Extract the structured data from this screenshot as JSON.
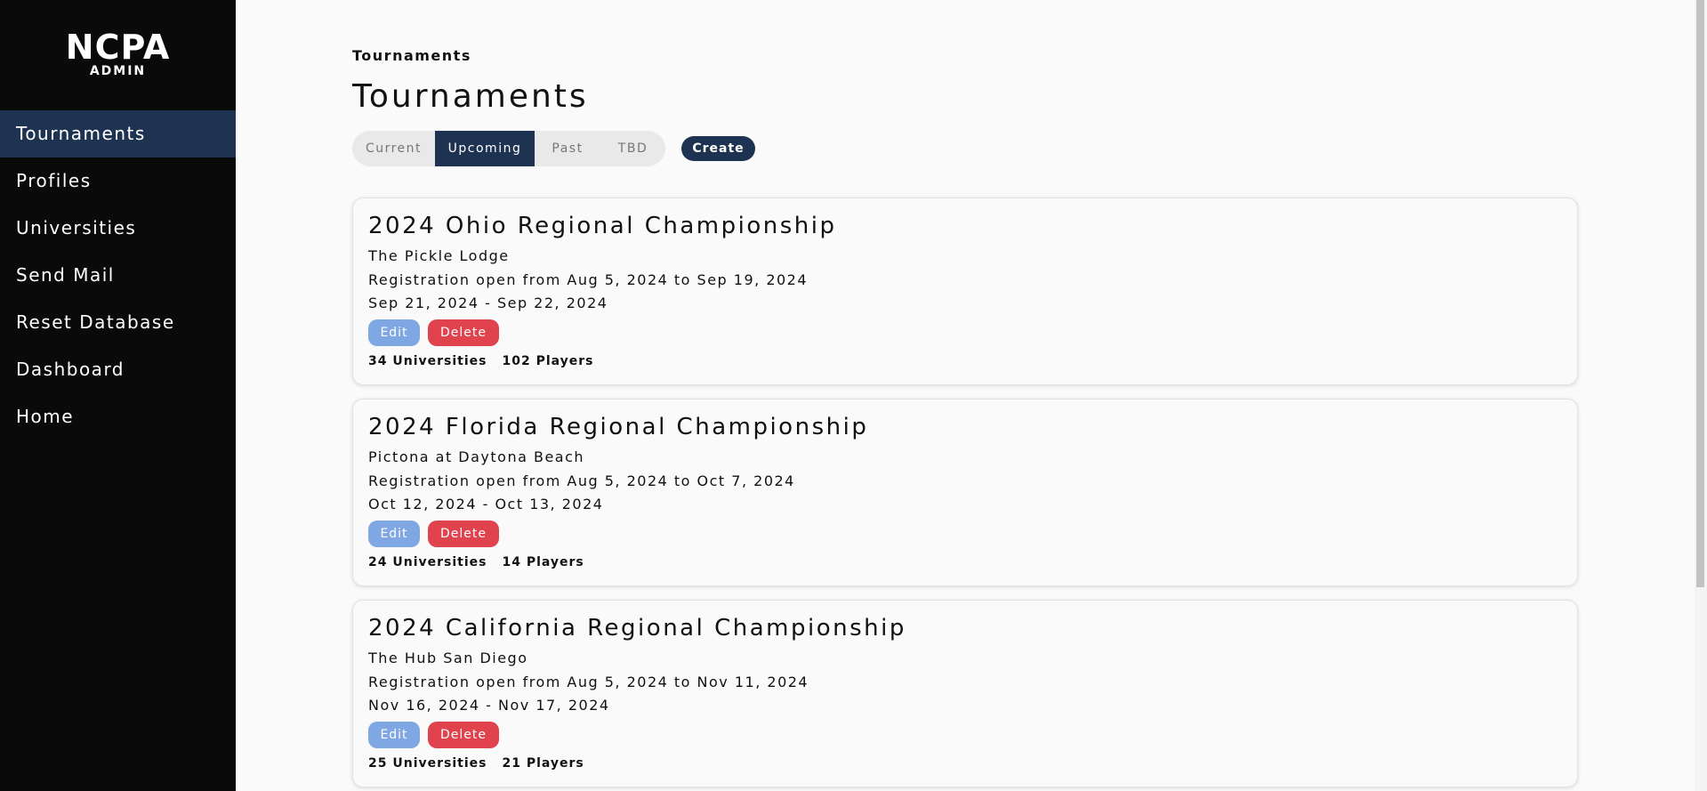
{
  "logo": {
    "main": "NCPA",
    "sub": "ADMIN"
  },
  "sidebar": {
    "items": [
      {
        "label": "Tournaments"
      },
      {
        "label": "Profiles"
      },
      {
        "label": "Universities"
      },
      {
        "label": "Send Mail"
      },
      {
        "label": "Reset Database"
      },
      {
        "label": "Dashboard"
      },
      {
        "label": "Home"
      }
    ],
    "active": "Tournaments"
  },
  "breadcrumb": "Tournaments",
  "page_title": "Tournaments",
  "tabs": [
    {
      "label": "Current"
    },
    {
      "label": "Upcoming"
    },
    {
      "label": "Past"
    },
    {
      "label": "TBD"
    }
  ],
  "selected_tab": "Upcoming",
  "create_label": "Create",
  "tournaments": [
    {
      "title": "2024 Ohio Regional Championship",
      "venue": "The Pickle Lodge",
      "registration": "Registration open from Aug 5, 2024 to Sep 19, 2024",
      "dates": "Sep 21, 2024 - Sep 22, 2024",
      "edit_label": "Edit",
      "delete_label": "Delete",
      "universities": "34 Universities",
      "players": "102 Players"
    },
    {
      "title": "2024 Florida Regional Championship",
      "venue": "Pictona at Daytona Beach",
      "registration": "Registration open from Aug 5, 2024 to Oct 7, 2024",
      "dates": "Oct 12, 2024 - Oct 13, 2024",
      "edit_label": "Edit",
      "delete_label": "Delete",
      "universities": "24 Universities",
      "players": "14 Players"
    },
    {
      "title": "2024 California Regional Championship",
      "venue": "The Hub San Diego",
      "registration": "Registration open from Aug 5, 2024 to Nov 11, 2024",
      "dates": "Nov 16, 2024 - Nov 17, 2024",
      "edit_label": "Edit",
      "delete_label": "Delete",
      "universities": "25 Universities",
      "players": "21 Players"
    }
  ],
  "colors": {
    "sidebar_bg": "#0a0a0a",
    "accent": "#1e3352",
    "edit": "#7ea7e3",
    "delete": "#e0434e"
  }
}
